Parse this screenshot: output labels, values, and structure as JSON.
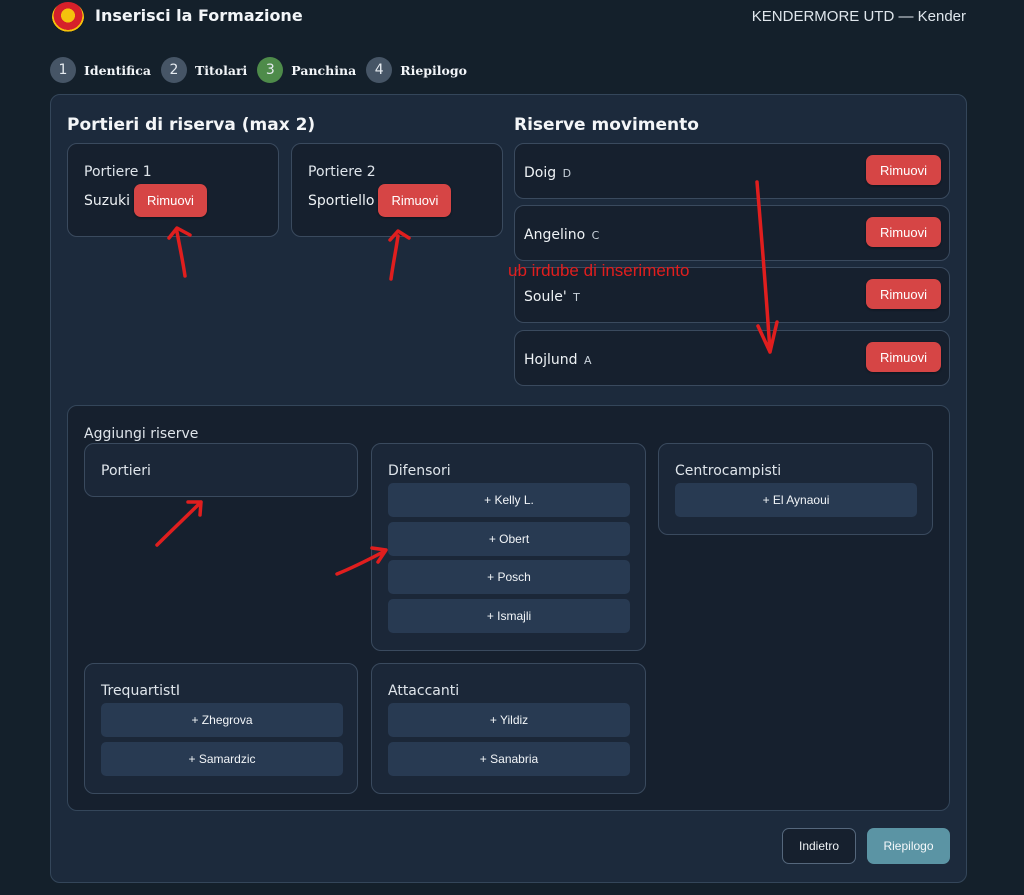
{
  "header": {
    "title": "Inserisci la Formazione",
    "team": "KENDERMORE UTD — Kender"
  },
  "stepper": [
    {
      "num": "1",
      "label": "Identifica"
    },
    {
      "num": "2",
      "label": "Titolari"
    },
    {
      "num": "3",
      "label": "Panchina"
    },
    {
      "num": "4",
      "label": "Riepilogo"
    }
  ],
  "goalkeepers": {
    "title": "Portieri di riserva (max 2)",
    "slots": [
      {
        "label": "Portiere 1",
        "name": "Suzuki",
        "remove": "Rimuovi"
      },
      {
        "label": "Portiere 2",
        "name": "Sportiello",
        "remove": "Rimuovi"
      }
    ]
  },
  "reserves": {
    "title": "Riserve movimento",
    "items": [
      {
        "name": "Doig",
        "role": "D",
        "remove": "Rimuovi"
      },
      {
        "name": "Angelino",
        "role": "C",
        "remove": "Rimuovi"
      },
      {
        "name": "Soule'",
        "role": "T",
        "remove": "Rimuovi"
      },
      {
        "name": "Hojlund",
        "role": "A",
        "remove": "Rimuovi"
      }
    ]
  },
  "add": {
    "title": "Aggiungi riserve",
    "portieri": {
      "title": "Portieri"
    },
    "difensori": {
      "title": "Difensori",
      "players": [
        "+ Kelly L.",
        "+ Obert",
        "+ Posch",
        "+ Ismajli"
      ]
    },
    "centrocampisti": {
      "title": "Centrocampisti",
      "players": [
        "+ El Aynaoui"
      ]
    },
    "trequartisti": {
      "title": "TrequartistI",
      "players": [
        "+ Zhegrova",
        "+ Samardzic"
      ]
    },
    "attaccanti": {
      "title": "Attaccanti",
      "players": [
        "+ Yildiz",
        "+ Sanabria"
      ]
    }
  },
  "footer": {
    "back": "Indietro",
    "summary": "Riepilogo"
  },
  "annotation": {
    "text": "ub irdube di inserimento",
    "color": "#e01e1e"
  },
  "colors": {
    "remove": "#d64545",
    "active_step": "#4e8b4a",
    "primary": "#5b94a4"
  }
}
